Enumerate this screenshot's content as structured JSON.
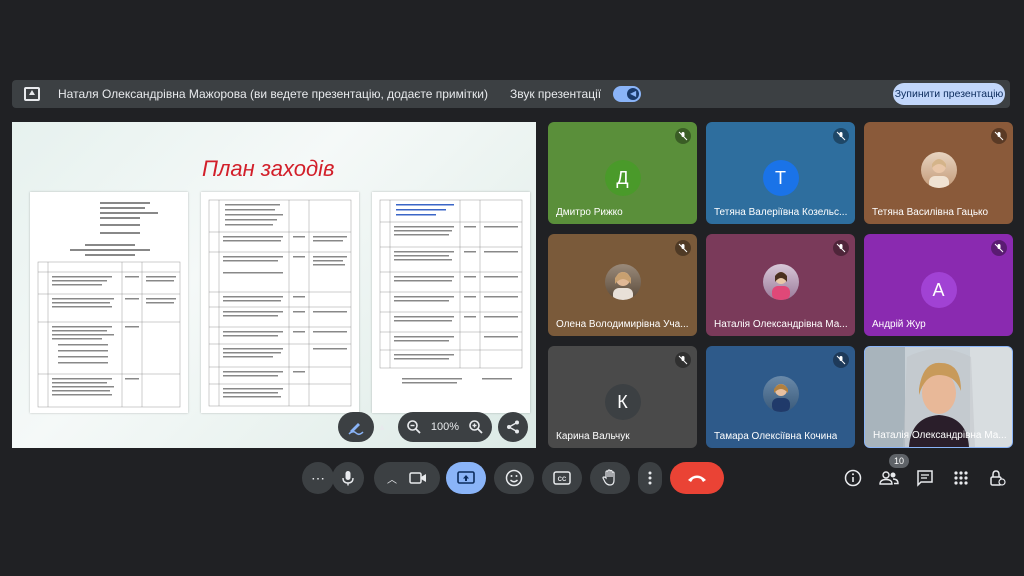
{
  "presenting_bar": {
    "presenter_text": "Наталя Олександрівна Мажорова (ви ведете презентацію, додаєте примітки)",
    "sound_label": "Звук презентації",
    "stop_button_label": "Зупинити презентацію"
  },
  "shared_screen": {
    "slide_title": "План заходів"
  },
  "zoom": {
    "level": "100%"
  },
  "tiles": [
    {
      "name": "Дмитро Рижко",
      "initial": "Д",
      "avatar_color": "#4a9a2a",
      "bg": "#5a8f3a",
      "muted": true
    },
    {
      "name": "Тетяна Валеріївна Козельс...",
      "initial": "Т",
      "avatar_color": "#1a73e8",
      "bg": "#2e6e9e",
      "muted": true
    },
    {
      "name": "Тетяна Василівна Гацько",
      "bg": "#8a5a3a",
      "muted": true
    },
    {
      "name": "Олена Володимирівна Уча...",
      "bg": "#7a5a3a",
      "muted": true
    },
    {
      "name": "Наталія Олександрівна Ма...",
      "bg": "#7a3a5a",
      "muted": true
    },
    {
      "name": "Андрій Жур",
      "initial": "А",
      "avatar_color": "#a142d4",
      "bg": "#8a2ab0",
      "muted": true
    },
    {
      "name": "Карина Вальчук",
      "initial": "К",
      "avatar_color": "#3c4043",
      "bg": "#4a4a4a",
      "muted": true
    },
    {
      "name": "Тамара Олексіївна Кочина",
      "bg": "#2e5a8a",
      "muted": true
    },
    {
      "name": "Наталія Олександрівна Ма...",
      "bg": "#b8c0c8",
      "muted": false
    }
  ],
  "toolbar": {
    "more_label": "⋯",
    "participants_count": "10"
  },
  "icons": [
    "present-icon",
    "mic-icon",
    "camera-icon",
    "present-screen-icon",
    "emoji-icon",
    "captions-icon",
    "hand-icon",
    "more-icon",
    "end-call-icon",
    "info-icon",
    "people-icon",
    "chat-icon",
    "apps-icon",
    "lock-icon"
  ]
}
